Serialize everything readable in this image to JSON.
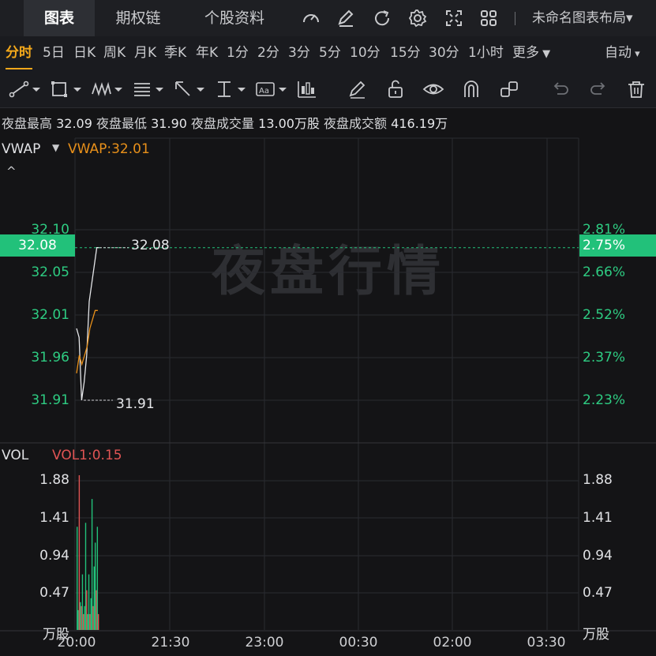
{
  "tabs": [
    {
      "label": "图表",
      "active": true
    },
    {
      "label": "期权链",
      "active": false
    },
    {
      "label": "个股资料",
      "active": false
    }
  ],
  "top_icons": [
    "speed-gauge-icon",
    "edit-note-icon",
    "refresh-icon",
    "gear-icon",
    "fullscreen-icon",
    "layout-grid-icon"
  ],
  "layout": {
    "name": "未命名图表布局",
    "chevron": "▾"
  },
  "periods": [
    "分时",
    "5日",
    "日K",
    "周K",
    "月K",
    "季K",
    "年K",
    "1分",
    "2分",
    "3分",
    "5分",
    "10分",
    "15分",
    "30分",
    "1小时"
  ],
  "more_label": "更多",
  "auto_label": "自动",
  "active_period": "分时",
  "info": {
    "high_label": "夜盘最高",
    "high": "32.09",
    "low_label": "夜盘最低",
    "low": "31.90",
    "volume_label": "夜盘成交量",
    "volume": "13.00万股",
    "amount_label": "夜盘成交额",
    "amount": "416.19万"
  },
  "vwap": {
    "name": "VWAP",
    "label": "VWAP:32.01"
  },
  "vol": {
    "name": "VOL",
    "label": "VOL1:0.15"
  },
  "watermark": "夜盘行情",
  "price_badge_left": "32.08",
  "price_badge_right": "2.75%",
  "high_marker": "32.08",
  "low_marker": "31.91",
  "colors": {
    "up": "#22c17a",
    "down": "#e05454",
    "vwap": "#e8901a",
    "price": "#e4e5e8",
    "active": "#f3a81b"
  },
  "chart_data": {
    "type": "line",
    "price_axis_left": [
      "32.10",
      "32.05",
      "32.01",
      "31.96",
      "31.91"
    ],
    "price_axis_right": [
      "2.81%",
      "2.66%",
      "2.52%",
      "2.37%",
      "2.23%"
    ],
    "ylim": [
      31.88,
      32.15
    ],
    "volume_axis": [
      "1.88",
      "1.41",
      "0.94",
      "0.47"
    ],
    "volume_unit": "万股",
    "x_ticks": [
      "20:00",
      "21:30",
      "23:00",
      "00:30",
      "02:00",
      "03:30"
    ],
    "series": [
      {
        "name": "price",
        "values": [
          31.99,
          31.98,
          31.91,
          31.93,
          31.96,
          32.02,
          32.04,
          32.06,
          32.08,
          32.08
        ]
      },
      {
        "name": "VWAP",
        "values": [
          31.94,
          31.96,
          31.95,
          31.96,
          31.97,
          31.99,
          32.0,
          32.01,
          32.01
        ]
      }
    ],
    "volume": [
      1.3,
      0.25,
      1.95,
      0.35,
      0.3,
      0.7,
      0.2,
      0.3,
      1.35,
      0.5,
      0.2,
      0.7,
      0.2,
      0.4,
      1.65,
      0.3,
      0.8,
      1.1,
      0.5,
      1.3,
      0.2
    ],
    "volume_direction": [
      "up",
      "up",
      "down",
      "up",
      "down",
      "up",
      "down",
      "up",
      "up",
      "down",
      "up",
      "up",
      "down",
      "up",
      "up",
      "down",
      "up",
      "up",
      "down",
      "up",
      "down"
    ]
  }
}
